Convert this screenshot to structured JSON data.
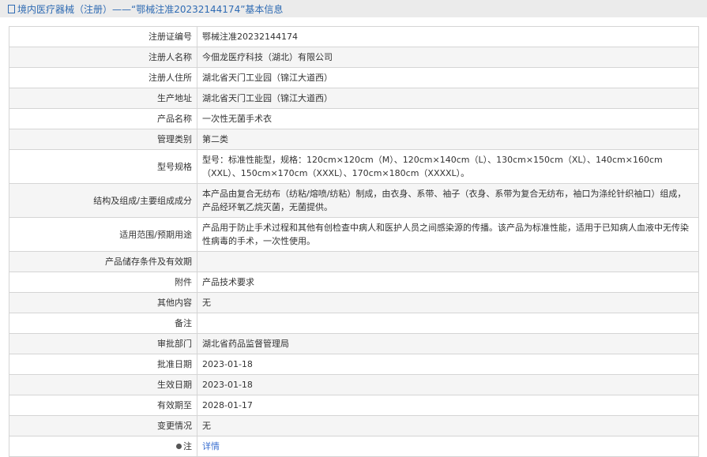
{
  "header": {
    "title": "境内医疗器械（注册）——“鄂械注准20232144174”基本信息"
  },
  "rows": [
    {
      "label": "注册证编号",
      "value": "鄂械注准20232144174"
    },
    {
      "label": "注册人名称",
      "value": "今佃龙医疗科技（湖北）有限公司"
    },
    {
      "label": "注册人住所",
      "value": "湖北省天门工业园（锦江大道西）"
    },
    {
      "label": "生产地址",
      "value": "湖北省天门工业园（锦江大道西）"
    },
    {
      "label": "产品名称",
      "value": "一次性无菌手术衣"
    },
    {
      "label": "管理类别",
      "value": "第二类"
    },
    {
      "label": "型号规格",
      "value": "型号：标准性能型，规格：120cm×120cm（M）、120cm×140cm（L）、130cm×150cm（XL）、140cm×160cm（XXL）、150cm×170cm（XXXL）、170cm×180cm（XXXXL）。"
    },
    {
      "label": "结构及组成/主要组成成分",
      "value": "本产品由复合无纺布（纺粘/熔喷/纺粘）制成，由衣身、系带、袖子（衣身、系带为复合无纺布，袖口为涤纶针织袖口）组成，产品经环氧乙烷灭菌，无菌提供。"
    },
    {
      "label": "适用范围/预期用途",
      "value": "产品用于防止手术过程和其他有创检查中病人和医护人员之间感染源的传播。该产品为标准性能，适用于已知病人血液中无传染性病毒的手术，一次性使用。"
    },
    {
      "label": "产品储存条件及有效期",
      "value": ""
    },
    {
      "label": "附件",
      "value": "产品技术要求"
    },
    {
      "label": "其他内容",
      "value": "无"
    },
    {
      "label": "备注",
      "value": ""
    },
    {
      "label": "审批部门",
      "value": "湖北省药品监督管理局"
    },
    {
      "label": "批准日期",
      "value": "2023-01-18"
    },
    {
      "label": "生效日期",
      "value": "2023-01-18"
    },
    {
      "label": "有效期至",
      "value": "2028-01-17"
    },
    {
      "label": "变更情况",
      "value": "无"
    }
  ],
  "note": {
    "label": "注",
    "link": "详情"
  }
}
